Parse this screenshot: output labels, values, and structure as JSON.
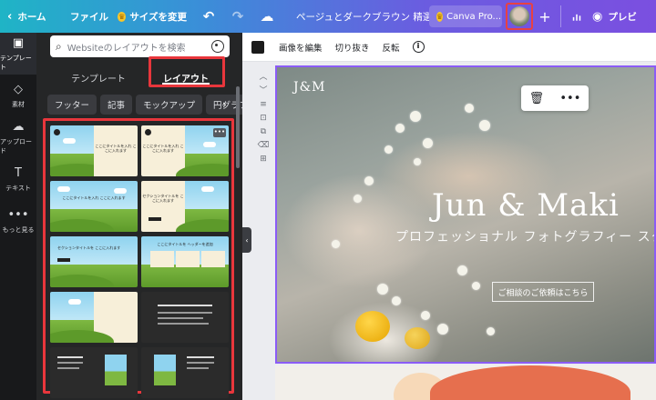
{
  "topbar": {
    "home": "ホーム",
    "file": "ファイル",
    "resize": "サイズを変更",
    "title": "ページュとダークブラウン 精選され...",
    "pro": "Canva Pro...",
    "preview": "プレビ"
  },
  "rail": {
    "items": [
      {
        "label": "テンプレート",
        "icon": "layout-icon"
      },
      {
        "label": "素材",
        "icon": "shapes-icon"
      },
      {
        "label": "アップロード",
        "icon": "upload-icon"
      },
      {
        "label": "テキスト",
        "icon": "text-icon"
      },
      {
        "label": "もっと見る",
        "icon": "more-icon"
      }
    ]
  },
  "panel": {
    "search_placeholder": "Websiteのレイアウトを検索",
    "tabs": [
      {
        "label": "テンプレート",
        "active": false
      },
      {
        "label": "レイアウト",
        "active": true
      }
    ],
    "chips": [
      "フッター",
      "記事",
      "モックアップ",
      "円グラフ"
    ],
    "thumbs": {
      "t1": "ここにタイトルを入れ ここに入れます",
      "t2": "ここにタイトルを入れ ここに入れます",
      "t3": "ここにタイトルを入れ ここに入れます",
      "t4": "セクションタイトルを ここに入れます",
      "t5": "セクションタイトルを ここに入れます",
      "t6": "ここにタイトルを ヘッダーを追加"
    }
  },
  "editor_toolbar": {
    "edit_image": "画像を編集",
    "crop": "切り抜き",
    "flip": "反転",
    "swatch_color": "#1b1b1b"
  },
  "canvas": {
    "logo": "J&M",
    "hero_title": "Jun & Maki",
    "hero_subtitle": "プロフェッショナル フォトグラフィー スタ",
    "cta": "ご相談のご依頼はこちら"
  },
  "colors": {
    "highlight": "#e8363c",
    "selection": "#8b5cf6"
  }
}
